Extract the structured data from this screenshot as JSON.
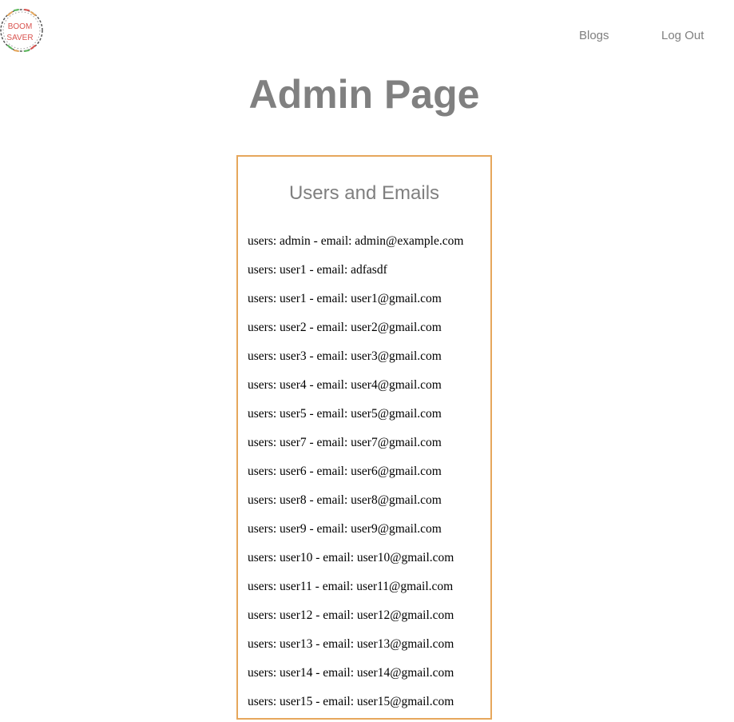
{
  "logo": {
    "line1": "BOOM",
    "line2": "SAVER",
    "icon": "boom-saver-logo-icon"
  },
  "nav": {
    "blogs": "Blogs",
    "logout": "Log Out"
  },
  "page_title": "Admin Page",
  "panel": {
    "title": "Users and Emails",
    "rows": [
      "users: admin - email: admin@example.com",
      "users: user1 - email: adfasdf",
      "users: user1 - email: user1@gmail.com",
      "users: user2 - email: user2@gmail.com",
      "users: user3 - email: user3@gmail.com",
      "users: user4 - email: user4@gmail.com",
      "users: user5 - email: user5@gmail.com",
      "users: user7 - email: user7@gmail.com",
      "users: user6 - email: user6@gmail.com",
      "users: user8 - email: user8@gmail.com",
      "users: user9 - email: user9@gmail.com",
      "users: user10 - email: user10@gmail.com",
      "users: user11 - email: user11@gmail.com",
      "users: user12 - email: user12@gmail.com",
      "users: user13 - email: user13@gmail.com",
      "users: user14 - email: user14@gmail.com",
      "users: user15 - email: user15@gmail.com"
    ]
  },
  "colors": {
    "panel_border": "#e6a75c",
    "title_gray": "#808080",
    "logo_text": "#d9534f"
  }
}
